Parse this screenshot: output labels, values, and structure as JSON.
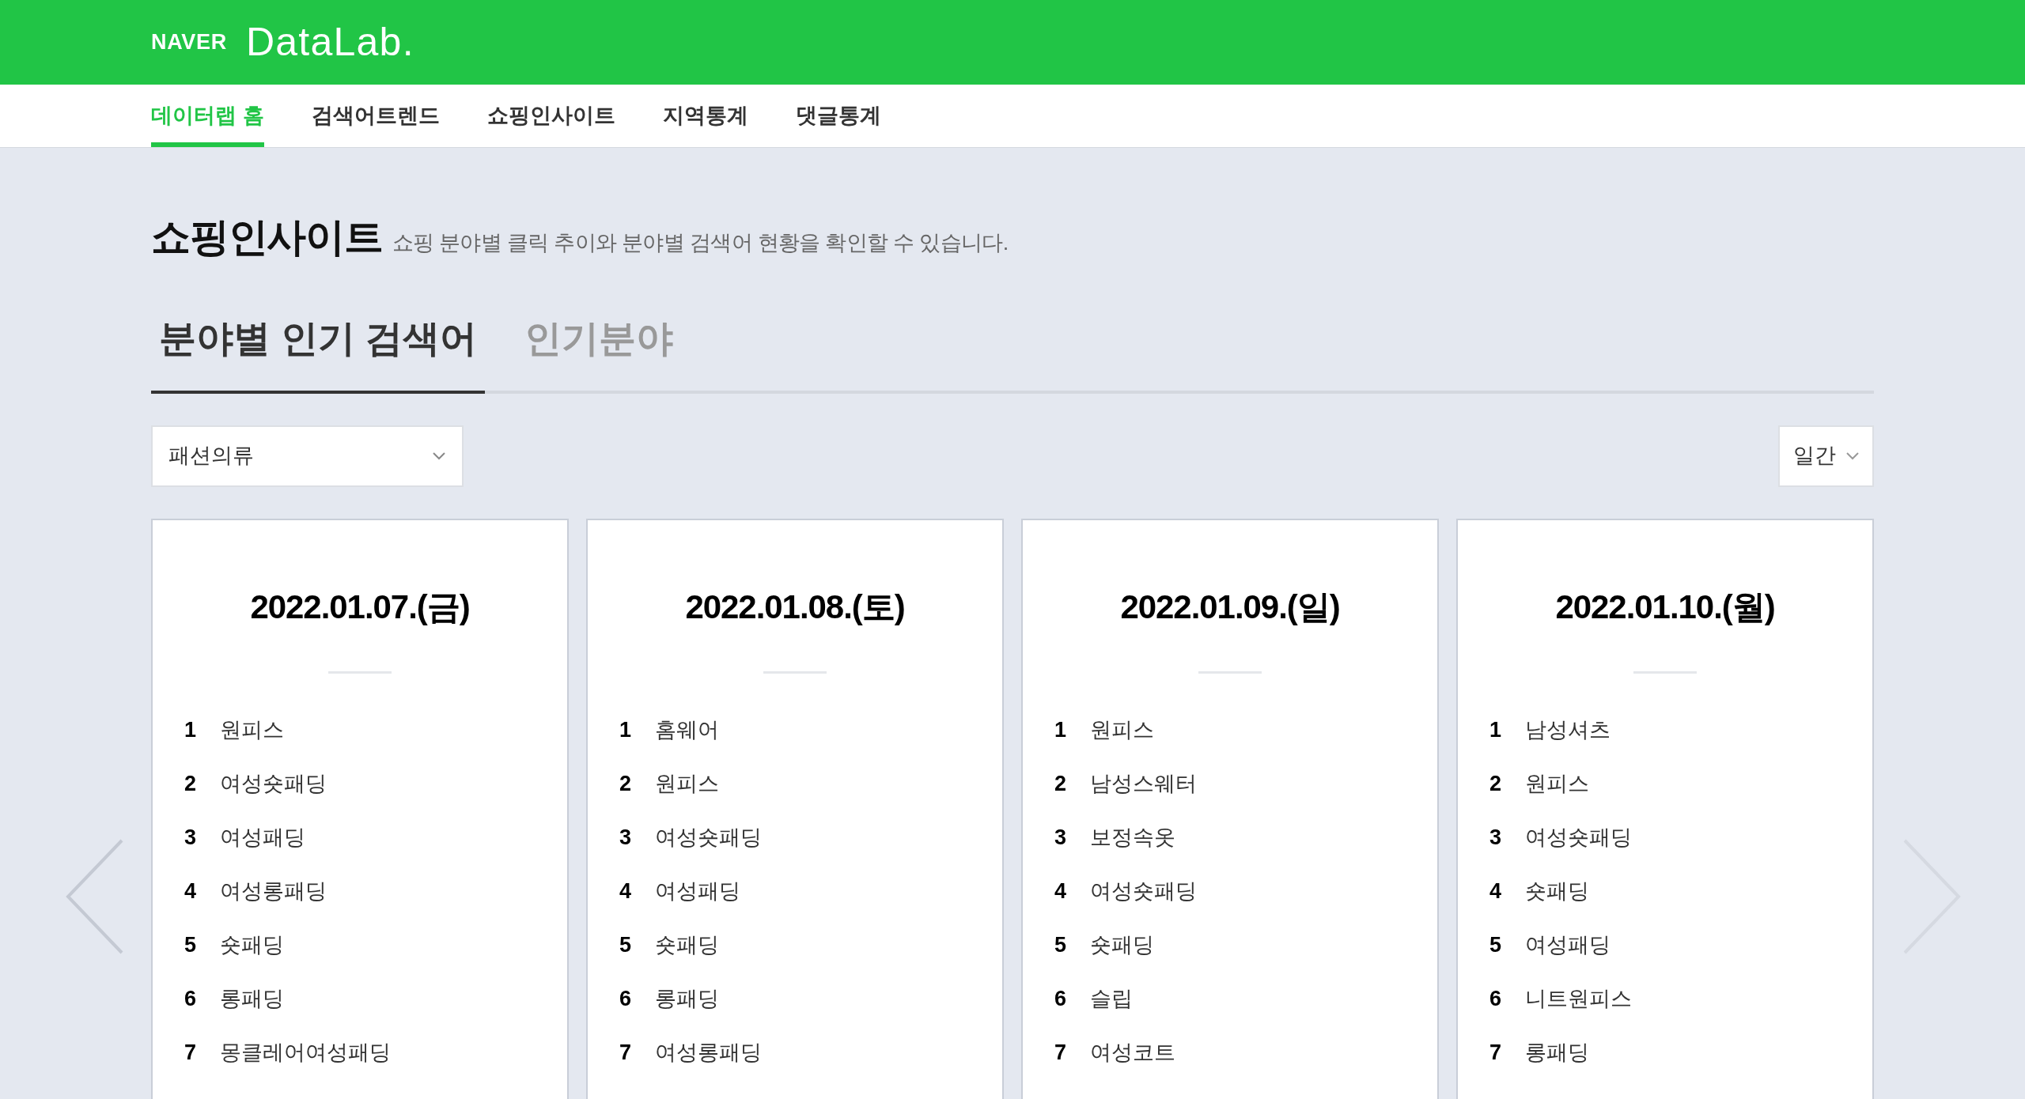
{
  "header": {
    "brand": "NAVER",
    "product": "DataLab."
  },
  "nav": [
    {
      "label": "데이터랩 홈",
      "selected": true
    },
    {
      "label": "검색어트렌드",
      "selected": false
    },
    {
      "label": "쇼핑인사이트",
      "selected": false
    },
    {
      "label": "지역통계",
      "selected": false
    },
    {
      "label": "댓글통계",
      "selected": false
    }
  ],
  "page": {
    "title": "쇼핑인사이트",
    "description": "쇼핑 분야별 클릭 추이와 분야별 검색어 현황을 확인할 수 있습니다."
  },
  "tabs": [
    {
      "label": "분야별 인기 검색어",
      "selected": true
    },
    {
      "label": "인기분야",
      "selected": false
    }
  ],
  "category_select": {
    "value": "패션의류"
  },
  "period_select": {
    "value": "일간"
  },
  "cards": [
    {
      "date": "2022.01.07.(금)",
      "rows": [
        {
          "rank": "1",
          "keyword": "원피스"
        },
        {
          "rank": "2",
          "keyword": "여성숏패딩"
        },
        {
          "rank": "3",
          "keyword": "여성패딩"
        },
        {
          "rank": "4",
          "keyword": "여성롱패딩"
        },
        {
          "rank": "5",
          "keyword": "숏패딩"
        },
        {
          "rank": "6",
          "keyword": "롱패딩"
        },
        {
          "rank": "7",
          "keyword": "몽클레어여성패딩"
        }
      ]
    },
    {
      "date": "2022.01.08.(토)",
      "rows": [
        {
          "rank": "1",
          "keyword": "홈웨어"
        },
        {
          "rank": "2",
          "keyword": "원피스"
        },
        {
          "rank": "3",
          "keyword": "여성숏패딩"
        },
        {
          "rank": "4",
          "keyword": "여성패딩"
        },
        {
          "rank": "5",
          "keyword": "숏패딩"
        },
        {
          "rank": "6",
          "keyword": "롱패딩"
        },
        {
          "rank": "7",
          "keyword": "여성롱패딩"
        }
      ]
    },
    {
      "date": "2022.01.09.(일)",
      "rows": [
        {
          "rank": "1",
          "keyword": "원피스"
        },
        {
          "rank": "2",
          "keyword": "남성스웨터"
        },
        {
          "rank": "3",
          "keyword": "보정속옷"
        },
        {
          "rank": "4",
          "keyword": "여성숏패딩"
        },
        {
          "rank": "5",
          "keyword": "숏패딩"
        },
        {
          "rank": "6",
          "keyword": "슬립"
        },
        {
          "rank": "7",
          "keyword": "여성코트"
        }
      ]
    },
    {
      "date": "2022.01.10.(월)",
      "rows": [
        {
          "rank": "1",
          "keyword": "남성셔츠"
        },
        {
          "rank": "2",
          "keyword": "원피스"
        },
        {
          "rank": "3",
          "keyword": "여성숏패딩"
        },
        {
          "rank": "4",
          "keyword": "숏패딩"
        },
        {
          "rank": "5",
          "keyword": "여성패딩"
        },
        {
          "rank": "6",
          "keyword": "니트원피스"
        },
        {
          "rank": "7",
          "keyword": "롱패딩"
        }
      ]
    }
  ]
}
